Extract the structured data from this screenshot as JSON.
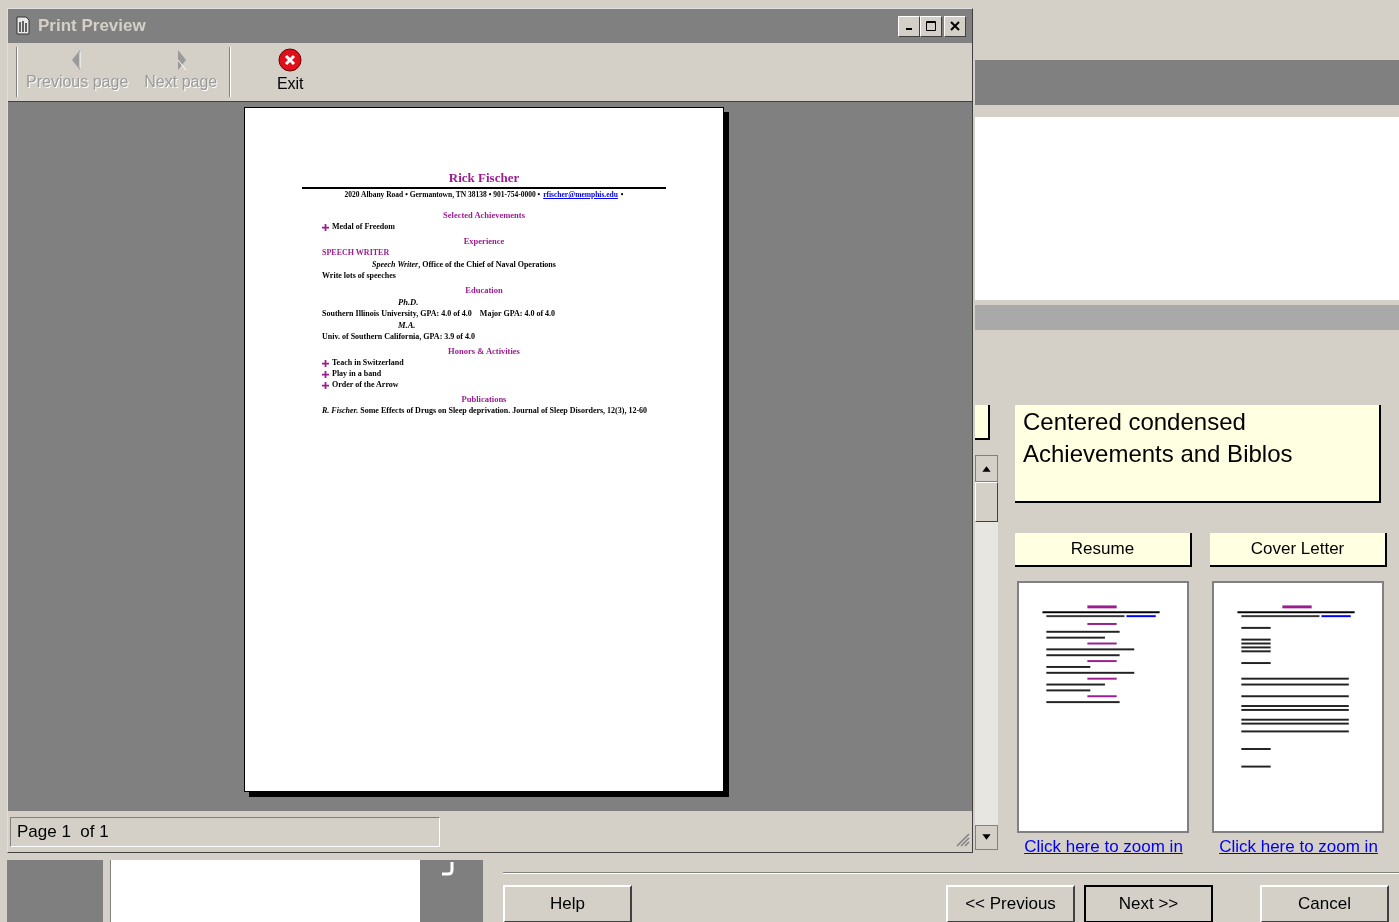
{
  "window": {
    "title": "Print Preview"
  },
  "toolbar": [
    {
      "label": "Previous page",
      "kind": "prev",
      "disabled": true
    },
    {
      "label": "Next page",
      "kind": "next",
      "disabled": true
    },
    {
      "label": "Exit",
      "kind": "exit",
      "disabled": false
    }
  ],
  "document": {
    "name": "Rick Fischer",
    "contact": "2020 Albany Road • Germantown, TN 38138 • 901-754-0000 •",
    "email": "rfischer@memphis.edu",
    "contact_end": "•",
    "blocks": [
      {
        "kind": "heading",
        "text": "Selected Achievements"
      },
      {
        "kind": "bullet",
        "text": "Medal of Freedom"
      },
      {
        "kind": "heading",
        "text": "Experience"
      },
      {
        "kind": "caps",
        "text": "SPEECH WRITER"
      },
      {
        "kind": "role",
        "text": "*Speech Writer*, Office of the Chief of Naval Operations"
      },
      {
        "kind": "line",
        "text": "Write lots of speeches"
      },
      {
        "kind": "heading",
        "text": "Education"
      },
      {
        "kind": "degree",
        "text": "Ph.D."
      },
      {
        "kind": "line",
        "text": "Southern Illinois University, GPA: 4.0 of 4.0    Major GPA: 4.0 of 4.0"
      },
      {
        "kind": "degree",
        "text": "M.A."
      },
      {
        "kind": "line",
        "text": "Univ. of Southern California, GPA: 3.9 of 4.0"
      },
      {
        "kind": "heading",
        "text": "Honors & Activities"
      },
      {
        "kind": "bullet",
        "text": "Teach in Switzerland"
      },
      {
        "kind": "bullet",
        "text": "Play in a band"
      },
      {
        "kind": "bullet",
        "text": "Order of the Arrow"
      },
      {
        "kind": "heading",
        "text": "Publications"
      },
      {
        "kind": "line",
        "text": "*R. Fischer.* Some Effects of Drugs on Sleep deprivation. Journal of Sleep Disorders, 12(3), 12-60"
      }
    ]
  },
  "status": {
    "page": "Page 1  of 1"
  },
  "wizard": {
    "note": "Centered condensed Achievements and Biblos",
    "templates": [
      {
        "label": "Resume",
        "kind": "resume",
        "link": "Click here to zoom in"
      },
      {
        "label": "Cover Letter",
        "kind": "letter",
        "link": "Click here to zoom in"
      }
    ],
    "buttons": [
      {
        "label": "Help",
        "kind": "help"
      },
      {
        "label": "<< Previous",
        "kind": "nav"
      },
      {
        "label": "Next >>",
        "kind": "default"
      },
      {
        "label": "Cancel",
        "kind": "cancel"
      }
    ]
  }
}
